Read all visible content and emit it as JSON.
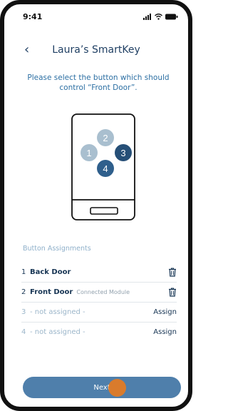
{
  "status_bar": {
    "time": "9:41"
  },
  "header": {
    "title": "Laura’s SmartKey",
    "back_glyph": "‹"
  },
  "instruction": "Please select the button which should control “Front Door”.",
  "key_buttons": [
    {
      "number": "1",
      "selected": false
    },
    {
      "number": "2",
      "selected": false
    },
    {
      "number": "3",
      "selected": true
    },
    {
      "number": "4",
      "selected": true
    }
  ],
  "assignments": {
    "label": "Button Assignments",
    "rows": [
      {
        "number": "1",
        "name": "Back Door",
        "sub": "",
        "action": "delete-icon"
      },
      {
        "number": "2",
        "name": "Front Door",
        "sub": "Connected Module",
        "action": "delete-icon"
      },
      {
        "number": "3",
        "name": "- not assigned -",
        "sub": "",
        "action": "Assign"
      },
      {
        "number": "4",
        "name": "- not assigned -",
        "sub": "",
        "action": "Assign"
      }
    ]
  },
  "next_button": {
    "label": "Next"
  },
  "colors": {
    "primary": "#4f7fab",
    "dark": "#1f3f63",
    "muted": "#9cb6ca",
    "touch": "#e07b25"
  }
}
